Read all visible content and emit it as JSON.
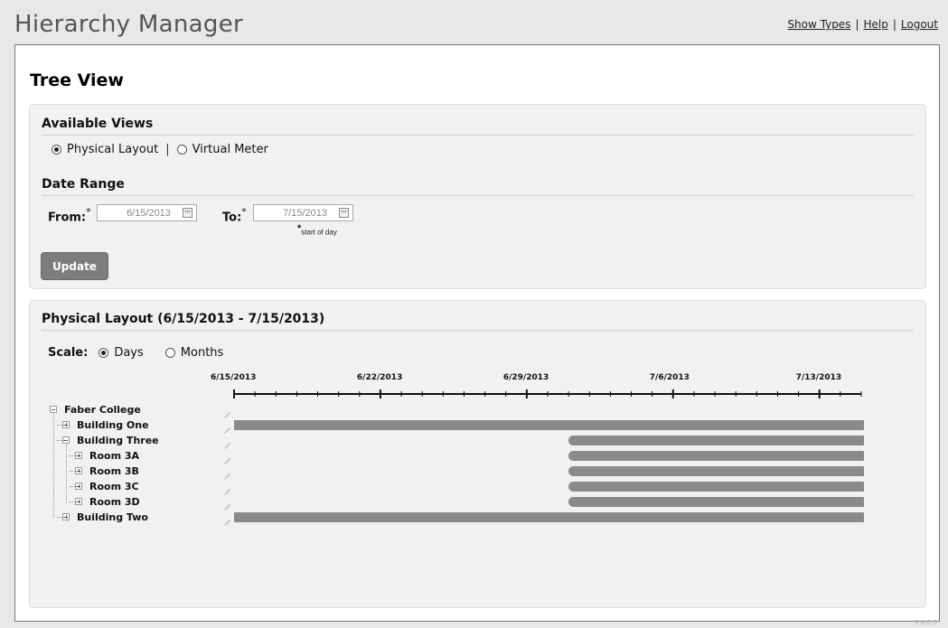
{
  "app": {
    "title": "Hierarchy Manager",
    "version": "1.0.0.0"
  },
  "nav": {
    "show_types": "Show Types",
    "help": "Help",
    "logout": "Logout",
    "separator": "|"
  },
  "page": {
    "title": "Tree View"
  },
  "views": {
    "title": "Available Views",
    "options": [
      {
        "label": "Physical Layout",
        "selected": true
      },
      {
        "label": "Virtual Meter",
        "selected": false
      }
    ],
    "separator": "|"
  },
  "date_range": {
    "title": "Date Range",
    "from_label": "From:",
    "from_value": "6/15/2013",
    "to_label": "To:",
    "to_value": "7/15/2013",
    "required_mark": "*",
    "note": "start of day"
  },
  "update_button": {
    "label": "Update"
  },
  "layout_panel": {
    "title": "Physical Layout (6/15/2013 - 7/15/2013)",
    "scale_label": "Scale:",
    "scale_options": [
      {
        "label": "Days",
        "selected": true
      },
      {
        "label": "Months",
        "selected": false
      }
    ],
    "axis": {
      "start": "6/15/2013",
      "end": "7/15/2013",
      "tick_labels": [
        "6/15/2013",
        "6/22/2013",
        "6/29/2013",
        "7/6/2013",
        "7/13/2013"
      ],
      "unit": "days"
    },
    "tree": [
      {
        "name": "Faber College",
        "level": 0,
        "expanded": true,
        "active_from": null,
        "active_to": null
      },
      {
        "name": "Building One",
        "level": 1,
        "expanded": false,
        "active_from": "6/15/2013",
        "active_to": "7/15/2013"
      },
      {
        "name": "Building Three",
        "level": 1,
        "expanded": true,
        "active_from": "7/1/2013",
        "active_to": "7/15/2013"
      },
      {
        "name": "Room 3A",
        "level": 2,
        "expanded": false,
        "active_from": "7/1/2013",
        "active_to": "7/15/2013"
      },
      {
        "name": "Room 3B",
        "level": 2,
        "expanded": false,
        "active_from": "7/1/2013",
        "active_to": "7/15/2013"
      },
      {
        "name": "Room 3C",
        "level": 2,
        "expanded": false,
        "active_from": "7/1/2013",
        "active_to": "7/15/2013"
      },
      {
        "name": "Room 3D",
        "level": 2,
        "expanded": false,
        "active_from": "7/1/2013",
        "active_to": "7/15/2013"
      },
      {
        "name": "Building Two",
        "level": 1,
        "expanded": false,
        "active_from": "6/15/2013",
        "active_to": "7/15/2013"
      }
    ],
    "bar_color": "#8a8a8a"
  }
}
